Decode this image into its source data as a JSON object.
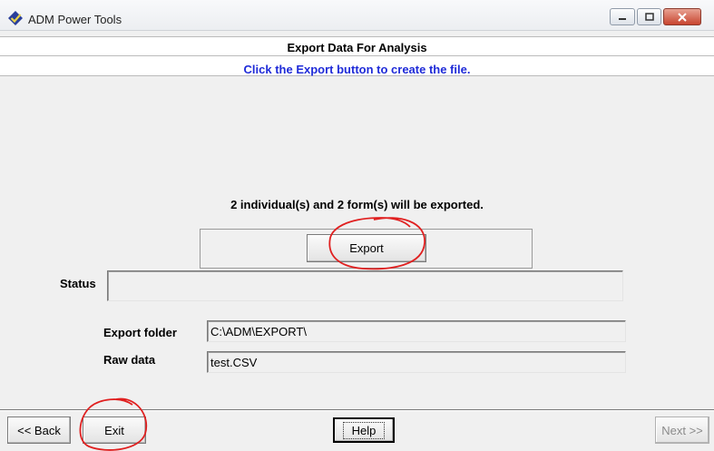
{
  "window": {
    "title": "ADM Power Tools",
    "icon": "checkmark-diamond-icon"
  },
  "header": {
    "title": "Export Data For Analysis",
    "subtitle": "Click the Export button to create the file.",
    "subtitle_color": "#1f2bd8"
  },
  "summary": "2 individual(s) and 2 form(s) will be exported.",
  "export_button": {
    "label": "Export"
  },
  "status": {
    "label": "Status",
    "value": ""
  },
  "export_folder": {
    "label": "Export folder",
    "value": "C:\\ADM\\EXPORT\\"
  },
  "raw_data": {
    "label": "Raw data",
    "value": "test.CSV"
  },
  "footer": {
    "back_label": "<< Back",
    "exit_label": "Exit",
    "help_label": "Help",
    "next_label": "Next >>"
  },
  "annotation_color": "#e02020"
}
